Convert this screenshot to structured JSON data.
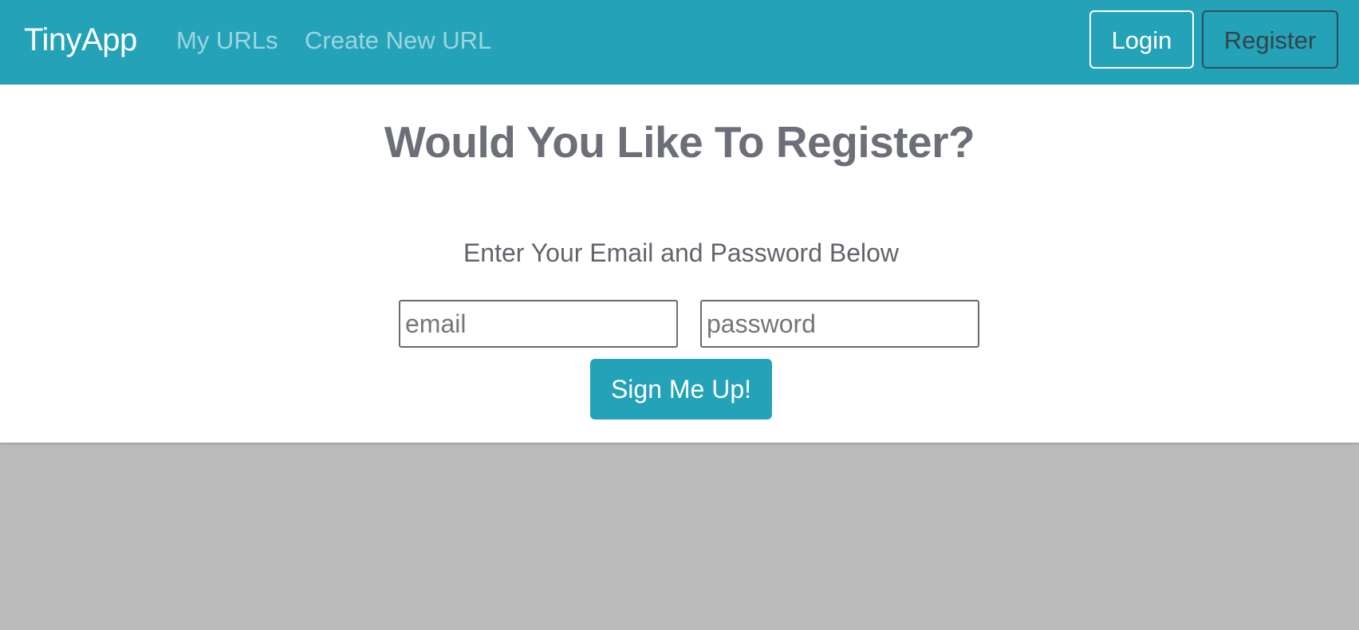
{
  "navbar": {
    "brand": "TinyApp",
    "links": [
      {
        "label": "My URLs"
      },
      {
        "label": "Create New URL"
      }
    ],
    "login_label": "Login",
    "register_label": "Register"
  },
  "main": {
    "title": "Would You Like To Register?",
    "subtitle": "Enter Your Email and Password Below",
    "email_placeholder": "email",
    "password_placeholder": "password",
    "submit_label": "Sign Me Up!"
  },
  "colors": {
    "accent": "#24a2b8",
    "page_background": "#bbbbbb",
    "card_background": "#ffffff"
  }
}
